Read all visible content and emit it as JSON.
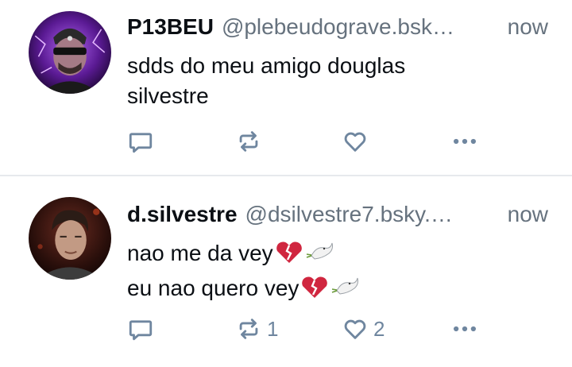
{
  "posts": [
    {
      "display_name": "P13BEU",
      "handle": "@plebeudograve.bsk…",
      "time": "now",
      "text_lines": [
        "sdds do meu amigo douglas",
        "silvestre"
      ],
      "emoji_lines": [],
      "reply_count": "",
      "repost_count": "",
      "like_count": ""
    },
    {
      "display_name": "d.silvestre",
      "handle": "@dsilvestre7.bsky.…",
      "time": "now",
      "text_lines": [
        "nao me da vey",
        "eu nao quero vey"
      ],
      "emoji_lines": [
        "💔🕊️",
        "💔🕊️"
      ],
      "reply_count": "",
      "repost_count": "1",
      "like_count": "2"
    }
  ],
  "icons": {
    "reply": "reply-icon",
    "repost": "repost-icon",
    "like": "heart-icon",
    "more": "more-options-icon"
  },
  "colors": {
    "action_gray": "#6f869f",
    "muted_text": "#66727e",
    "separator": "#e6e9ed",
    "heartbreak": "#d0263f"
  }
}
